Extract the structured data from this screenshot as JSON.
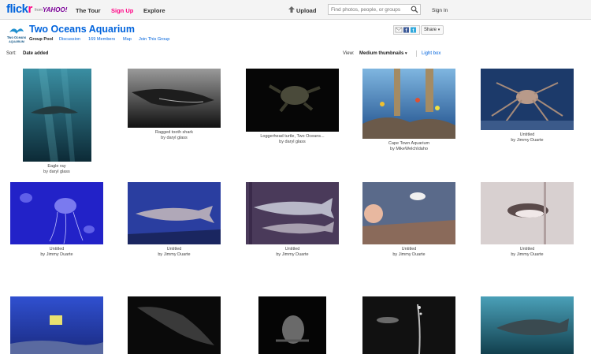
{
  "header": {
    "logo_main": "flick",
    "logo_accent": "r",
    "logo_from": "from",
    "logo_yahoo": "YAHOO!",
    "nav": [
      "The Tour",
      "Sign Up",
      "Explore"
    ],
    "upload_label": "Upload",
    "search_placeholder": "Find photos, people, or groups",
    "signin_label": "Sign In"
  },
  "group": {
    "title": "Two Oceans Aquarium",
    "logo_text_top": "Two Oceans",
    "logo_text_bottom": "AQUARIUM",
    "subnav": [
      "Group Pool",
      "Discussion",
      "169 Members",
      "Map",
      "Join This Group"
    ],
    "share_label": "Share"
  },
  "sortbar": {
    "sort_label": "Sort:",
    "sort_value": "Date added",
    "view_label": "View:",
    "view_value": "Medium thumbnails",
    "lightbox_label": "Light box"
  },
  "photos": [
    {
      "title": "Eagle ray",
      "author": "by daryl glass",
      "subject": "eagle ray"
    },
    {
      "title": "Ragged tooth shark",
      "author": "by daryl glass",
      "subject": "ragged tooth shark"
    },
    {
      "title": "Loggerhead turtle, Two Oceans...",
      "author": "by daryl glass",
      "subject": "loggerhead turtle"
    },
    {
      "title": "Cape Town Aquarium",
      "author": "by MikeWelchIdaho",
      "subject": "reef tank"
    },
    {
      "title": "Untitled",
      "author": "by Jimmy Duarte",
      "subject": "spider crab"
    },
    {
      "title": "Untitled",
      "author": "by Jimmy Duarte",
      "subject": "jellyfish"
    },
    {
      "title": "Untitled",
      "author": "by Jimmy Duarte",
      "subject": "shark"
    },
    {
      "title": "Untitled",
      "author": "by Jimmy Duarte",
      "subject": "fish"
    },
    {
      "title": "Untitled",
      "author": "by Jimmy Duarte",
      "subject": "child at penguin tank"
    },
    {
      "title": "Untitled",
      "author": "by Jimmy Duarte",
      "subject": "penguin"
    },
    {
      "subject": "boxfish"
    },
    {
      "subject": "stingray"
    },
    {
      "subject": "shark front"
    },
    {
      "subject": "diver"
    },
    {
      "subject": "shark tank"
    }
  ],
  "colors": {
    "brand_blue": "#0063dc",
    "brand_pink": "#ff0084"
  }
}
